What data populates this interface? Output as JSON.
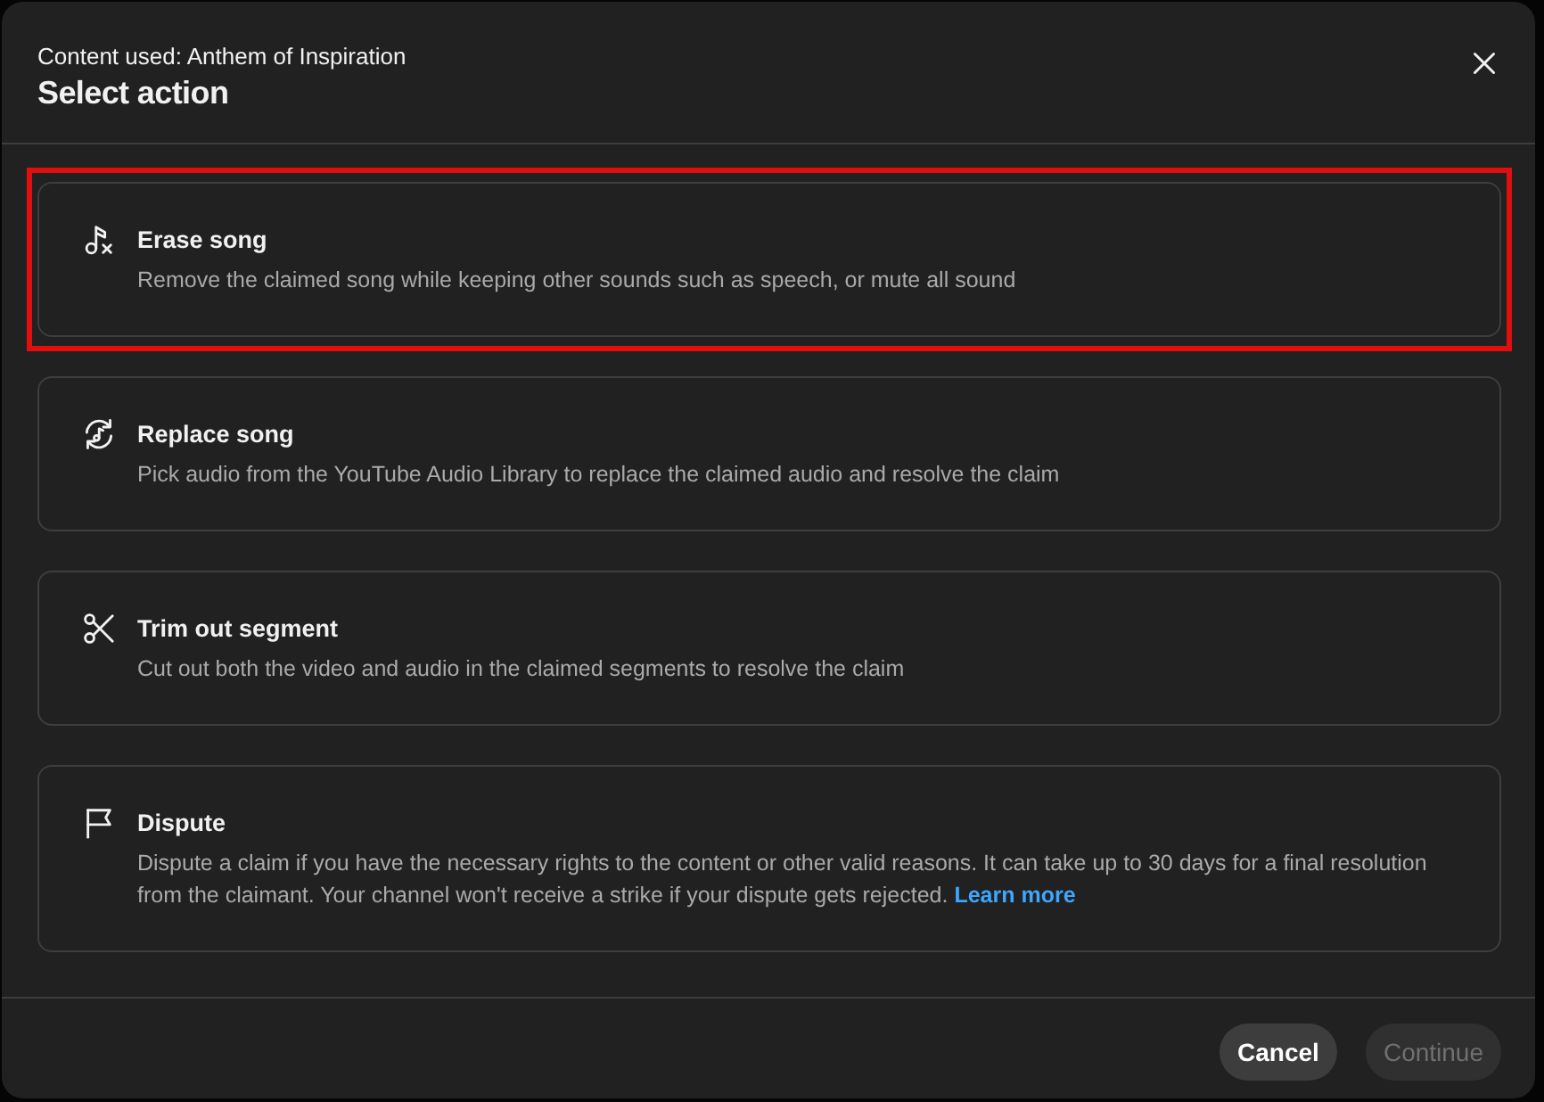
{
  "dialog": {
    "subtitle": "Content used: Anthem of Inspiration",
    "title": "Select action"
  },
  "options": [
    {
      "kind": "erase",
      "title": "Erase song",
      "description": "Remove the claimed song while keeping other sounds such as speech, or mute all sound",
      "highlighted": true
    },
    {
      "kind": "replace",
      "title": "Replace song",
      "description": "Pick audio from the YouTube Audio Library to replace the claimed audio and resolve the claim",
      "highlighted": false
    },
    {
      "kind": "trim",
      "title": "Trim out segment",
      "description": "Cut out both the video and audio in the claimed segments to resolve the claim",
      "highlighted": false
    },
    {
      "kind": "dispute",
      "title": "Dispute",
      "description": "Dispute a claim if you have the necessary rights to the content or other valid reasons. It can take up to 30 days for a final resolution from the claimant. Your channel won't receive a strike if your dispute gets rejected.",
      "link": "Learn more",
      "highlighted": false
    }
  ],
  "buttons": [
    {
      "kind": "secondary",
      "label": "Cancel",
      "disabled": false
    },
    {
      "kind": "primary",
      "label": "Continue",
      "disabled": true
    }
  ]
}
